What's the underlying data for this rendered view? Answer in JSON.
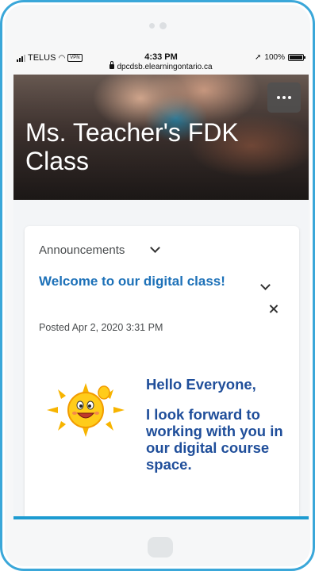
{
  "status_bar": {
    "carrier": "TELUS",
    "vpn": "VPN",
    "time": "4:33 PM",
    "url": "dpcdsb.elearningontario.ca",
    "battery": "100%"
  },
  "course": {
    "title": "Ms. Teacher's FDK Class"
  },
  "widget": {
    "title": "Announcements"
  },
  "announcement": {
    "title": "Welcome to our digital class!",
    "posted": "Posted Apr 2, 2020 3:31 PM",
    "greeting": "Hello Everyone,",
    "message": "I look forward to working with you in our digital course space."
  },
  "colors": {
    "frame": "#3aa7d9",
    "link": "#1d71b8",
    "message": "#1f4e9a"
  }
}
